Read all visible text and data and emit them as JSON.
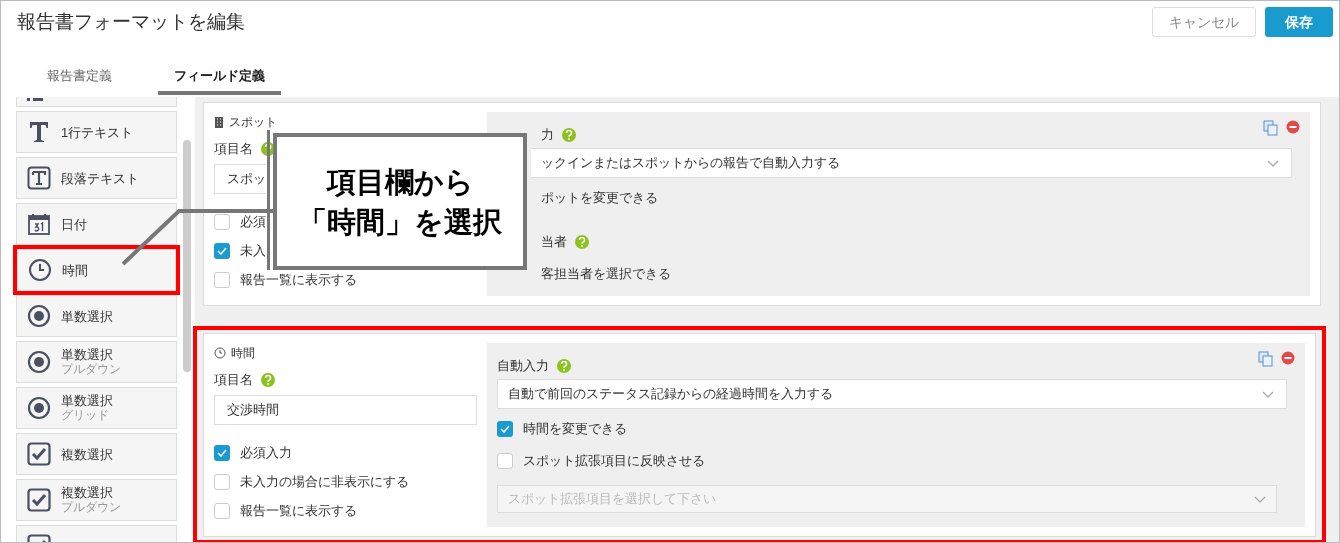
{
  "title": "報告書フォーマットを編集",
  "buttons": [
    {
      "label": "キャンセル",
      "kind": "secondary"
    },
    {
      "label": "保存",
      "kind": "primary"
    }
  ],
  "tabs": [
    {
      "label": "報告書定義",
      "selected": false
    },
    {
      "label": "フィールド定義",
      "selected": true
    }
  ],
  "palette": [
    {
      "label": "1行テキスト",
      "kind": "text",
      "highlighted": false
    },
    {
      "label": "段落テキスト",
      "kind": "paragraph",
      "highlighted": false
    },
    {
      "label": "日付",
      "kind": "date",
      "highlighted": false
    },
    {
      "label": "時間",
      "kind": "time",
      "highlighted": true
    },
    {
      "label": "単数選択",
      "kind": "radio",
      "highlighted": false
    },
    {
      "label": "単数選択",
      "sublabel": "プルダウン",
      "kind": "radio",
      "highlighted": false
    },
    {
      "label": "単数選択",
      "sublabel": "グリッド",
      "kind": "radio",
      "highlighted": false
    },
    {
      "label": "複数選択",
      "kind": "checkbox",
      "highlighted": false
    },
    {
      "label": "複数選択",
      "sublabel": "プルダウン",
      "kind": "checkbox",
      "highlighted": false
    },
    {
      "kind": "checkbox",
      "highlighted": false
    }
  ],
  "fields": [
    {
      "type_label": "スポット",
      "kind": "spot",
      "highlighted": false,
      "covered": true,
      "name_label": "項目名",
      "name_value": "スポッ",
      "options": [
        {
          "label": "必須",
          "checked": false
        },
        {
          "label": "未入",
          "checked": true
        },
        {
          "label": "報告一覧に表示する",
          "checked": false
        }
      ],
      "auto_label": "力",
      "settings": [
        {
          "kind": "select",
          "value": "ックインまたはスポットからの報告で自動入力する"
        },
        {
          "kind": "text",
          "label": "ポットを変更できる"
        },
        {
          "kind": "heading",
          "label": "当者"
        },
        {
          "kind": "text",
          "label": "客担当者を選択できる"
        }
      ]
    },
    {
      "type_label": "時間",
      "kind": "time",
      "highlighted": true,
      "covered": false,
      "name_label": "項目名",
      "name_value": "交渉時間",
      "options": [
        {
          "label": "必須入力",
          "checked": true
        },
        {
          "label": "未入力の場合に非表示にする",
          "checked": false
        },
        {
          "label": "報告一覧に表示する",
          "checked": false
        }
      ],
      "auto_label": "自動入力",
      "settings": [
        {
          "kind": "select",
          "value": "自動で前回のステータス記録からの経過時間を入力する"
        },
        {
          "kind": "checkbox",
          "label": "時間を変更できる",
          "checked": true
        },
        {
          "kind": "checkbox",
          "label": "スポット拡張項目に反映させる",
          "checked": false
        },
        {
          "kind": "disabled-select",
          "placeholder": "スポット拡張項目を選択して下さい"
        }
      ]
    }
  ],
  "callout": {
    "lines": [
      "項目欄から",
      "「時間」を選択"
    ]
  }
}
